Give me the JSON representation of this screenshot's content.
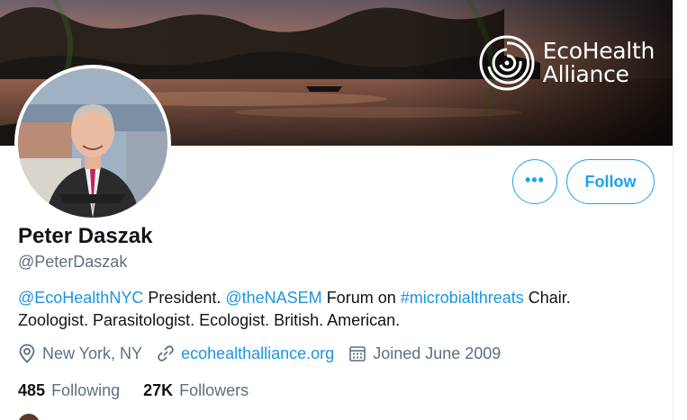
{
  "banner": {
    "brand_line1": "EcoHealth",
    "brand_line2": "Alliance",
    "logo_icon": "ecohealth-swirl-logo"
  },
  "profile": {
    "display_name": "Peter Daszak",
    "handle": "@PeterDaszak",
    "avatar_icon": "profile-photo"
  },
  "actions": {
    "more_label": "•••",
    "follow_label": "Follow"
  },
  "bio": {
    "mention1": "@EcoHealthNYC",
    "text1": " President. ",
    "mention2": "@theNASEM",
    "text2": " Forum on ",
    "hashtag": "#microbialthreats",
    "text3": " Chair.",
    "line2": "Zoologist. Parasitologist. Ecologist. British. American."
  },
  "meta": {
    "location": "New York, NY",
    "website": "ecohealthalliance.org",
    "joined": "Joined June 2009",
    "location_icon": "location-pin-icon",
    "link_icon": "link-icon",
    "calendar_icon": "calendar-icon"
  },
  "stats": {
    "following_count": "485",
    "following_label": "Following",
    "followers_count": "27K",
    "followers_label": "Followers"
  },
  "colors": {
    "accent": "#1da1f2",
    "link": "#1b95e0",
    "text_primary": "#0f1419",
    "text_secondary": "#5b7083"
  }
}
